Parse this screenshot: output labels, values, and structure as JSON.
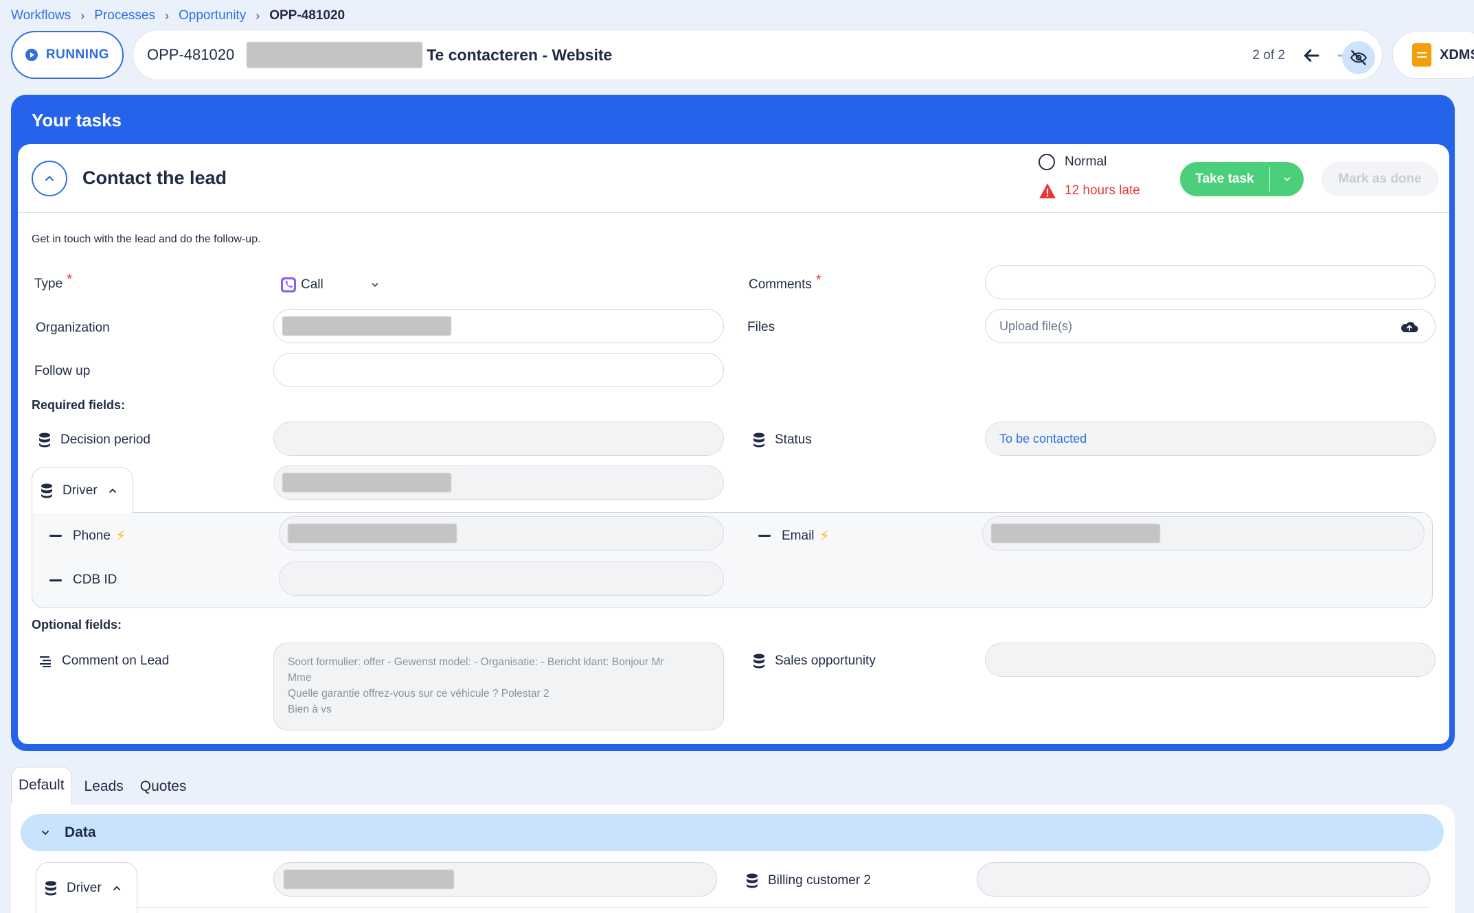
{
  "breadcrumb": {
    "items": [
      "Workflows",
      "Processes",
      "Opportunity"
    ],
    "current": "OPP-481020"
  },
  "header": {
    "status": "RUNNING",
    "opp_id": "OPP-481020",
    "title": "Te contacteren - Website",
    "pager": "2 of 2",
    "xdms_label": "XDMS"
  },
  "tasks": {
    "heading": "Your tasks",
    "task": {
      "title": "Contact the lead",
      "priority": "Normal",
      "late": "12 hours late",
      "take_task": "Take task",
      "mark_done": "Mark as done",
      "description": "Get in touch with the lead and do the follow-up."
    },
    "fields": {
      "type_label": "Type",
      "type_value": "Call",
      "comments_label": "Comments",
      "organization_label": "Organization",
      "files_label": "Files",
      "files_placeholder": "Upload file(s)",
      "follow_up_label": "Follow up"
    },
    "required": {
      "title": "Required fields:",
      "decision_period_label": "Decision period",
      "status_label": "Status",
      "status_value": "To be contacted",
      "driver_label": "Driver",
      "phone_label": "Phone",
      "email_label": "Email",
      "cdb_label": "CDB ID"
    },
    "optional": {
      "title": "Optional fields:",
      "comment_label": "Comment on Lead",
      "comment_lines": [
        "Soort formulier: offer - Gewenst model:  - Organisatie:  - Bericht klant: Bonjour Mr",
        "Mme",
        "Quelle garantie offrez-vous sur ce véhicule ? Polestar 2",
        "Bien à vs"
      ],
      "sales_opportunity_label": "Sales opportunity"
    }
  },
  "bottom": {
    "tabs": [
      "Default",
      "Leads",
      "Quotes"
    ],
    "data_section": "Data",
    "driver_label": "Driver",
    "billing_label": "Billing customer 2"
  },
  "colors": {
    "accent": "#2563eb",
    "success": "#4ccf7b",
    "danger": "#e53935",
    "warning": "#f5b400"
  }
}
